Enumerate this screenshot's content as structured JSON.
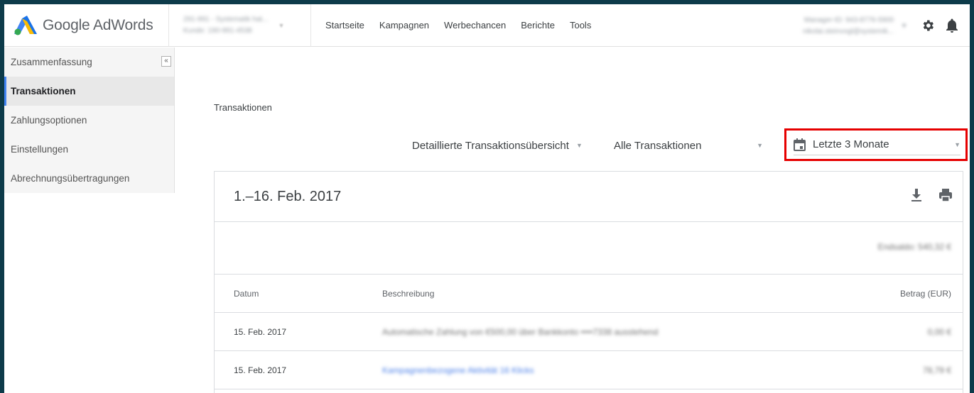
{
  "brand": {
    "name": "Google AdWords"
  },
  "account": {
    "line1": "291-991 - Systematik hat...",
    "line2": "Kunde: 190-991-4538"
  },
  "nav": {
    "items": [
      "Startseite",
      "Kampagnen",
      "Werbechancen",
      "Berichte",
      "Tools"
    ]
  },
  "manager": {
    "line1": "Manager-ID: 943-8776-5900",
    "line2": "nikolai.steinvogl@systemik..."
  },
  "sidebar": {
    "items": [
      {
        "label": "Zusammenfassung"
      },
      {
        "label": "Transaktionen"
      },
      {
        "label": "Zahlungsoptionen"
      },
      {
        "label": "Einstellungen"
      },
      {
        "label": "Abrechnungsübertragungen"
      }
    ],
    "active_index": 1,
    "collapse_label": "«"
  },
  "main": {
    "title": "Transaktionen",
    "filters": {
      "detail": "Detaillierte Transaktionsübersicht",
      "type": "Alle Transaktionen",
      "date": "Letzte 3 Monate"
    },
    "card": {
      "period": "1.–16. Feb. 2017",
      "end_balance": "Endsaldo: 540,32 €",
      "columns": {
        "date": "Datum",
        "description": "Beschreibung",
        "amount": "Betrag (EUR)"
      },
      "rows": [
        {
          "date": "15. Feb. 2017",
          "description": "Automatische Zahlung von €500,00 über Bankkonto ••••7338 ausstehend",
          "amount": "0,00 €"
        },
        {
          "date": "15. Feb. 2017",
          "description": "Kampagnenbezogene Aktivität 16 Klicks",
          "amount": "78,79 €"
        }
      ]
    }
  },
  "colors": {
    "highlight": "#e60000",
    "accent": "#4285f4"
  }
}
